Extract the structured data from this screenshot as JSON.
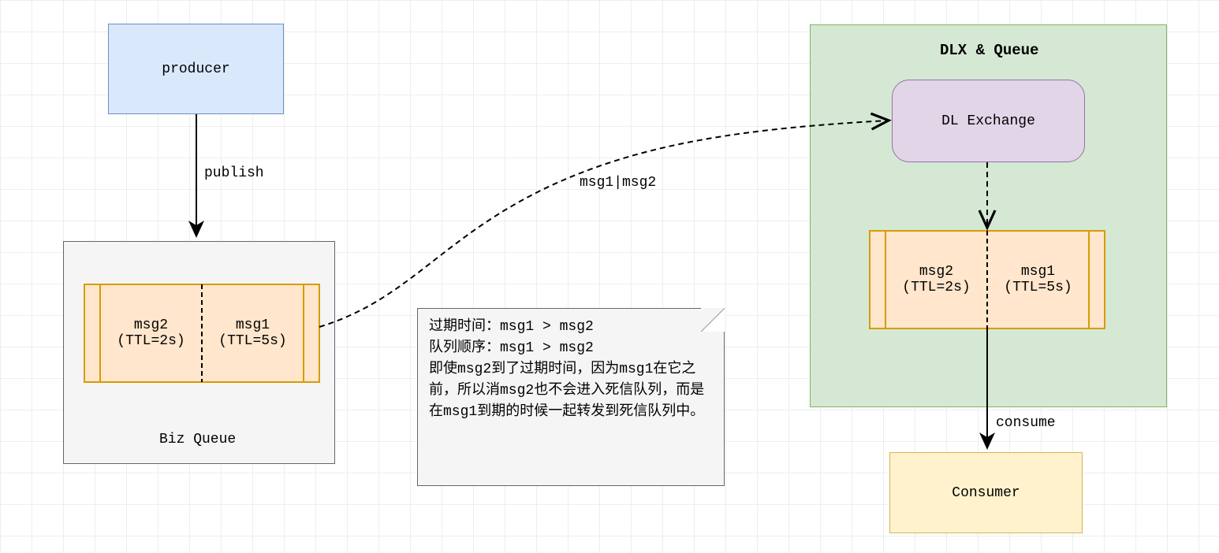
{
  "producer": {
    "label": "producer"
  },
  "publish_label": "publish",
  "biz_queue": {
    "label": "Biz Queue",
    "msg2": "msg2\n(TTL=2s)",
    "msg1": "msg1\n(TTL=5s)"
  },
  "transfer_label": "msg1|msg2",
  "note_text": "过期时间：msg1 > msg2\n队列顺序：msg1 > msg2\n即使msg2到了过期时间，因为msg1在它之前，所以消msg2也不会进入死信队列，而是在msg1到期的时候一起转发到死信队列中。",
  "dlx_queue": {
    "title": "DLX & Queue",
    "exchange_label": "DL Exchange",
    "msg2": "msg2\n(TTL=2s)",
    "msg1": "msg1\n(TTL=5s)"
  },
  "consume_label": "consume",
  "consumer": {
    "label": "Consumer"
  }
}
